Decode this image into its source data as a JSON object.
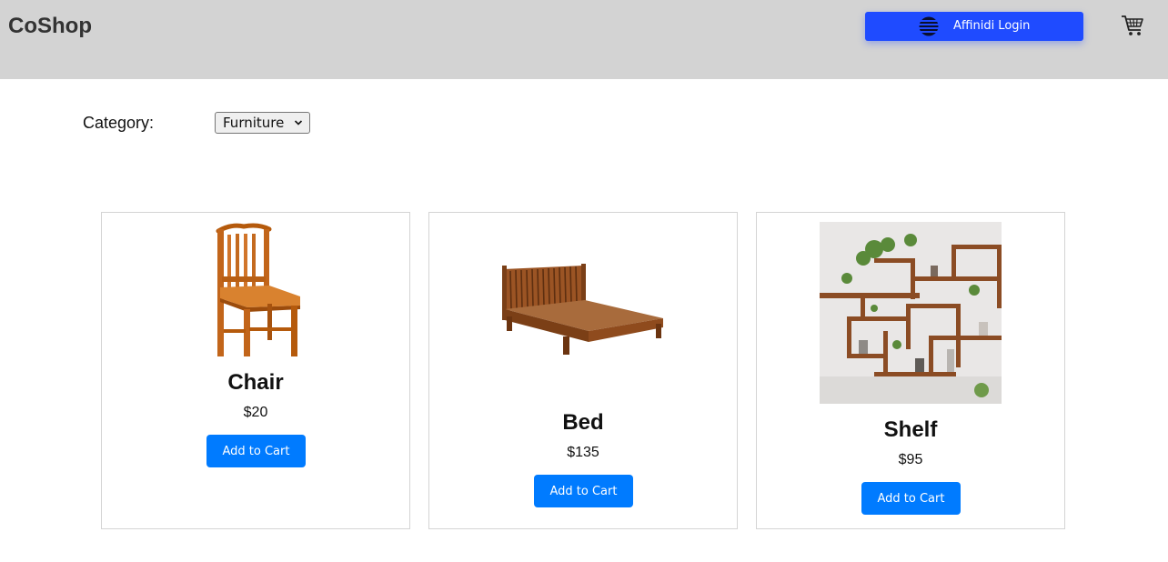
{
  "header": {
    "brand": "CoShop",
    "login_label": "Affinidi Login",
    "login_icon": "affinidi-logo-icon",
    "cart_icon": "shopping-cart-icon",
    "background": "#d3d3d3",
    "login_color": "#1f4bff"
  },
  "filter": {
    "label": "Category:",
    "selected": "Furniture"
  },
  "products": [
    {
      "name": "Chair",
      "price": "$20",
      "button": "Add to Cart",
      "image": "wooden-chair-image"
    },
    {
      "name": "Bed",
      "price": "$135",
      "button": "Add to Cart",
      "image": "wooden-bed-image"
    },
    {
      "name": "Shelf",
      "price": "$95",
      "button": "Add to Cart",
      "image": "wall-shelf-image"
    }
  ],
  "colors": {
    "button": "#007bff",
    "card_border": "#d4d4d4"
  }
}
